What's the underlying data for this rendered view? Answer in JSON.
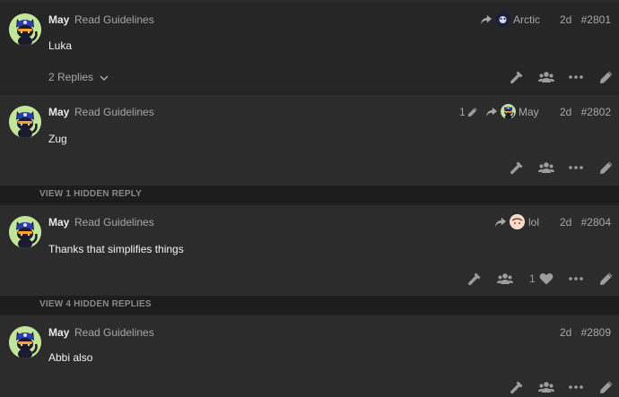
{
  "posts": [
    {
      "username": "May",
      "title": "Read Guidelines",
      "body": "Luka",
      "reply_to": "Arctic",
      "age": "2d",
      "number": "#2801",
      "replies": "2 Replies"
    },
    {
      "username": "May",
      "title": "Read Guidelines",
      "body": "Zug",
      "edit_count": "1",
      "reply_to": "May",
      "age": "2d",
      "number": "#2802"
    },
    {
      "username": "May",
      "title": "Read Guidelines",
      "body": "Thanks that simplifies things",
      "reply_to": "lol",
      "age": "2d",
      "number": "#2804",
      "likes": "1"
    },
    {
      "username": "May",
      "title": "Read Guidelines",
      "body": "Abbi also",
      "age": "2d",
      "number": "#2809"
    }
  ],
  "hidden_replies": [
    "VIEW 1 HIDDEN REPLY",
    "VIEW 4 HIDDEN REPLIES"
  ],
  "colors": {
    "background": "#222222",
    "post": "#2c2c2c",
    "avatar_bg": "#c3e59a",
    "hidden_bar": "#1d1d1d"
  }
}
